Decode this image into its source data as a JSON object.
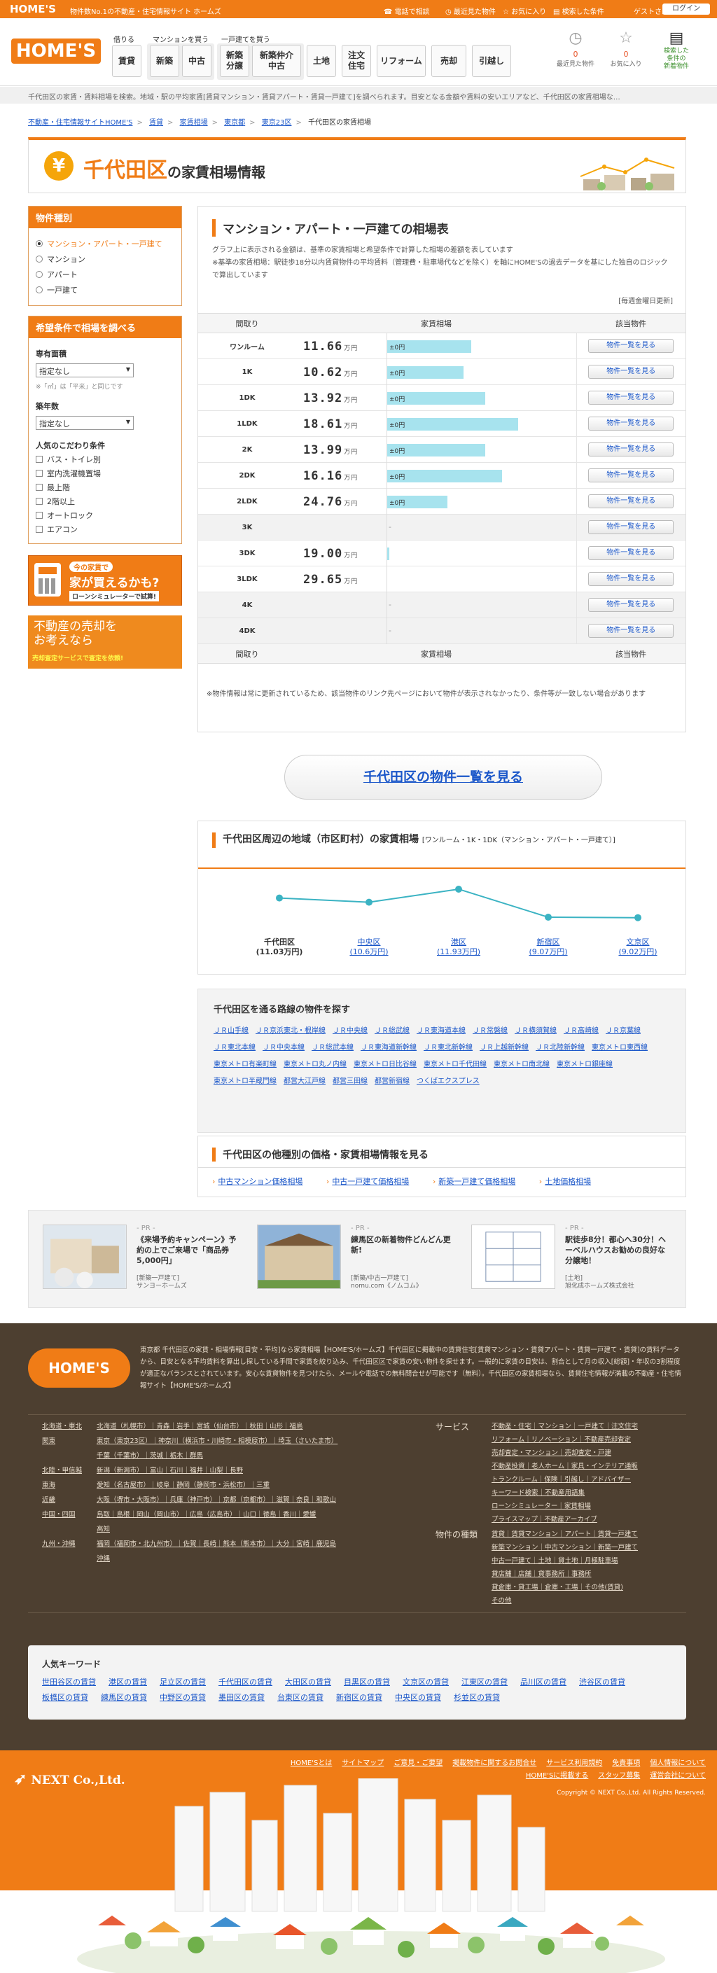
{
  "topbar": {
    "logo": "HOME'S",
    "tagline": "物件数No.1の不動産・住宅情報サイト ホームズ",
    "link1": "電話で相談",
    "link2": "最近見た物件",
    "link3": "お気に入り",
    "link4": "検索した条件",
    "guest": "ゲストさん",
    "login": "ログイン"
  },
  "header": {
    "logo": "HOME'S",
    "cats": [
      "借りる",
      "マンションを買う",
      "一戸建てを買う"
    ],
    "nav": [
      "賃貸",
      "新築",
      "中古",
      "新築\n分譲",
      "新築仲介\n中古",
      "土地",
      "注文\n住宅",
      "リフォーム",
      "売却",
      "引越し"
    ],
    "icons": [
      {
        "label": "最近見た物件",
        "num": "0"
      },
      {
        "label": "お気に入り",
        "num": "0"
      },
      {
        "label": "検索した\n条件の\n新着物件",
        "num": ""
      }
    ]
  },
  "breadtop": "千代田区の家賃・賃料相場を検索。地域・駅の平均家賃[賃貸マンション・賃貸アパート・賃貸一戸建て]を調べられます。目安となる金額や賃料の安いエリアなど、千代田区の家賃相場な…",
  "breadcrumb": [
    "不動産・住宅情報サイトHOME'S",
    "賃貸",
    "家賃相場",
    "東京都",
    "東京23区",
    "千代田区の家賃相場"
  ],
  "title": {
    "name": "千代田区",
    "suffix": "の家賃相場情報"
  },
  "sidebar": {
    "type_head": "物件種別",
    "types": [
      "マンション・アパート・一戸建て",
      "マンション",
      "アパート",
      "一戸建て"
    ],
    "cond_head": "希望条件で相場を調べる",
    "area_label": "専有面積",
    "area_value": "指定なし",
    "area_note": "※「㎡」は「平米」と同じです",
    "age_label": "築年数",
    "age_value": "指定なし",
    "pop_label": "人気のこだわり条件",
    "pops": [
      "バス・トイレ別",
      "室内洗濯機置場",
      "最上階",
      "2階以上",
      "オートロック",
      "エアコン"
    ],
    "banner1": {
      "small": "今の家賃で",
      "big": "家が買えるかも?",
      "sub": "ローンシミュレーターで試算!"
    },
    "banner2": {
      "big": "不動産の売却を\nお考えなら",
      "sub": "売却査定サービスで査定を依頼!"
    }
  },
  "main": {
    "title": "マンション・アパート・一戸建ての相場表",
    "desc": "グラフ上に表示される金額は、基準の家賃相場と希望条件で計算した相場の差額を表しています\n※基準の家賃相場：駅徒歩18分以内賃貸物件の平均賃料（管理費・駐車場代などを除く）を軸にHOME'Sの過去データを基にした独自のロジックで算出しています",
    "update": "[毎週金曜日更新]",
    "col_layout": "間取り",
    "col_rent": "家賃相場",
    "col_link": "該当物件",
    "unit": "万円",
    "delta": "±0円",
    "btn": "物件一覧を見る",
    "rows": [
      {
        "layout": "ワンルーム",
        "price": "11.66",
        "frac": 0.46
      },
      {
        "layout": "1K",
        "price": "10.62",
        "frac": 0.42
      },
      {
        "layout": "1DK",
        "price": "13.92",
        "frac": 0.54
      },
      {
        "layout": "1LDK",
        "price": "18.61",
        "frac": 0.72
      },
      {
        "layout": "2K",
        "price": "13.99",
        "frac": 0.54
      },
      {
        "layout": "2DK",
        "price": "16.16",
        "frac": 0.63
      },
      {
        "layout": "2LDK",
        "price": "24.76",
        "frac": 0.33
      },
      {
        "layout": "3K",
        "price": "",
        "frac": 0
      },
      {
        "layout": "3DK",
        "price": "19.00",
        "frac": 0.01
      },
      {
        "layout": "3LDK",
        "price": "29.65",
        "frac": 0
      },
      {
        "layout": "4K",
        "price": "",
        "frac": 0
      },
      {
        "layout": "4DK",
        "price": "",
        "frac": 0
      }
    ],
    "note": "※物件情報は常に更新されているため、該当物件のリンク先ページにおいて物件が表示されなかったり、条件等が一致しない場合があります"
  },
  "bigbtn": "千代田区の物件一覧を見る",
  "chart_data": {
    "type": "line",
    "title": "千代田区周辺の地域（市区町村）の家賃相場",
    "subtitle": "[ワンルーム・1K・1DK（マンション・アパート・一戸建て）]",
    "categories": [
      "千代田区",
      "中央区",
      "港区",
      "新宿区",
      "文京区"
    ],
    "values": [
      11.03,
      10.6,
      11.93,
      9.07,
      9.02
    ],
    "labels": [
      "(11.03万円)",
      "(10.6万円)",
      "(11.93万円)",
      "(9.07万円)",
      "(9.02万円)"
    ],
    "ylim": [
      8,
      13
    ],
    "color": "#3bb3c3"
  },
  "lines": {
    "title": "千代田区を通る路線の物件を探す",
    "items": [
      "ＪＲ山手線",
      "ＪＲ京浜東北・根岸線",
      "ＪＲ中央線",
      "ＪＲ総武線",
      "ＪＲ東海道本線",
      "ＪＲ常磐線",
      "ＪＲ横須賀線",
      "ＪＲ高崎線",
      "ＪＲ京葉線",
      "ＪＲ東北本線",
      "ＪＲ中央本線",
      "ＪＲ総武本線",
      "ＪＲ東海道新幹線",
      "ＪＲ東北新幹線",
      "ＪＲ上越新幹線",
      "ＪＲ北陸新幹線",
      "東京メトロ東西線",
      "東京メトロ有楽町線",
      "東京メトロ丸ノ内線",
      "東京メトロ日比谷線",
      "東京メトロ千代田線",
      "東京メトロ南北線",
      "東京メトロ銀座線",
      "東京メトロ半蔵門線",
      "都営大江戸線",
      "都営三田線",
      "都営新宿線",
      "つくばエクスプレス"
    ]
  },
  "other": {
    "title": "千代田区の他種別の価格・家賃相場情報を見る",
    "links": [
      "中古マンション価格相場",
      "中古一戸建て価格相場",
      "新築一戸建て価格相場",
      "土地価格相場"
    ]
  },
  "pr": [
    {
      "label": "- PR -",
      "title": "《来場予約キャンペーン》予約の上でご来場で「商品券5,000円」",
      "sub": "[新築一戸建て]\nサンヨーホームズ"
    },
    {
      "label": "- PR -",
      "title": "練馬区の新着物件どんどん更新!",
      "sub": "[新築/中古一戸建て]\nnomu.com《ノムコム》"
    },
    {
      "label": "- PR -",
      "title": "駅徒歩8分！都心へ30分！ヘーベルハウスお勧めの良好な分譲地！",
      "sub": "[土地]\n旭化成ホームズ株式会社"
    }
  ],
  "footer": {
    "logo": "HOME'S",
    "text": "東京都 千代田区の家賃・相場情報[目安・平均]なら家賃相場【HOME'S/ホームズ】千代田区に掲載中の賃貸住宅[賃貸マンション・賃貸アパート・賃貸一戸建て・賃貸]の賃料データから、目安となる平均賃料を算出し探している手間で家賃を絞り込み、千代田区区で家賃の安い物件を探せます。一般的に家賃の目安は、割合として月の収入[総額]・年収の3割程度が適正なバランスとされています。安心な賃貸物件を見つけたら、メールや電話での無料問合せが可能です（無料）。千代田区の家賃相場なら、賃貸住宅情報が満載の不動産・住宅情報サイト【HOME'S/ホームズ】",
    "regions": [
      {
        "n": "北海道・東北",
        "l": "北海道（札幌市）｜青森｜岩手｜宮城（仙台市）｜秋田｜山形｜福島"
      },
      {
        "n": "関東",
        "l": "東京（東京23区）｜神奈川（横浜市・川崎市・相模原市）｜埼玉（さいたま市）"
      },
      {
        "n": "",
        "l": "千葉（千葉市）｜茨城｜栃木｜群馬"
      },
      {
        "n": "北陸・甲信越",
        "l": "新潟（新潟市）｜富山｜石川｜福井｜山梨｜長野"
      },
      {
        "n": "東海",
        "l": "愛知（名古屋市）｜岐阜｜静岡（静岡市・浜松市）｜三重"
      },
      {
        "n": "近畿",
        "l": "大阪（堺市・大阪市）｜兵庫（神戸市）｜京都（京都市）｜滋賀｜奈良｜和歌山"
      },
      {
        "n": "中国・四国",
        "l": "鳥取｜島根｜岡山（岡山市）｜広島（広島市）｜山口｜徳島｜香川｜愛媛"
      },
      {
        "n": "",
        "l": "高知"
      },
      {
        "n": "九州・沖縄",
        "l": "福岡（福岡市・北九州市）｜佐賀｜長崎｜熊本（熊本市）｜大分｜宮崎｜鹿児島"
      },
      {
        "n": "",
        "l": "沖縄"
      }
    ],
    "service_head": "サービス",
    "services": [
      "不動産・住宅｜マンション｜一戸建て｜注文住宅",
      "リフォーム｜リノベーション｜不動産売却査定",
      "売却査定・マンション｜売却査定・戸建",
      "不動産投資｜老人ホーム｜家具・インテリア通販",
      "トランクルーム｜保険｜引越し｜アドバイザー",
      "キーワード検索｜不動産用語集",
      "ローンシミュレーター｜家賃相場",
      "プライスマップ｜不動産アーカイブ"
    ],
    "kind_head": "物件の種類",
    "kinds": [
      "賃貸｜賃貸マンション｜アパート｜賃貸一戸建て",
      "新築マンション｜中古マンション｜新築一戸建て",
      "中古一戸建て｜土地｜貸土地｜月極駐車場",
      "貸店舗｜店舗｜貸事務所｜事務所",
      "貸倉庫・貸工場｜倉庫・工場｜その他(賃貸)",
      "その他"
    ]
  },
  "keywords": {
    "title": "人気キーワード",
    "items": [
      "世田谷区の賃貸",
      "港区の賃貸",
      "足立区の賃貸",
      "千代田区の賃貸",
      "大田区の賃貸",
      "目黒区の賃貸",
      "文京区の賃貸",
      "江東区の賃貸",
      "品川区の賃貸",
      "渋谷区の賃貸",
      "板橋区の賃貸",
      "練馬区の賃貸",
      "中野区の賃貸",
      "墨田区の賃貸",
      "台東区の賃貸",
      "新宿区の賃貸",
      "中央区の賃貸",
      "杉並区の賃貸"
    ]
  },
  "bottom": {
    "company": "NEXT Co.,Ltd.",
    "links": [
      "HOME'Sとは",
      "サイトマップ",
      "ご意見・ご要望",
      "掲載物件に関するお問合せ",
      "サービス利用規約",
      "免責事項",
      "個人情報について",
      "HOME'Sに掲載する",
      "スタッフ募集",
      "運営会社について"
    ],
    "copy": "Copyright © NEXT Co.,Ltd. All Rights Reserved."
  }
}
